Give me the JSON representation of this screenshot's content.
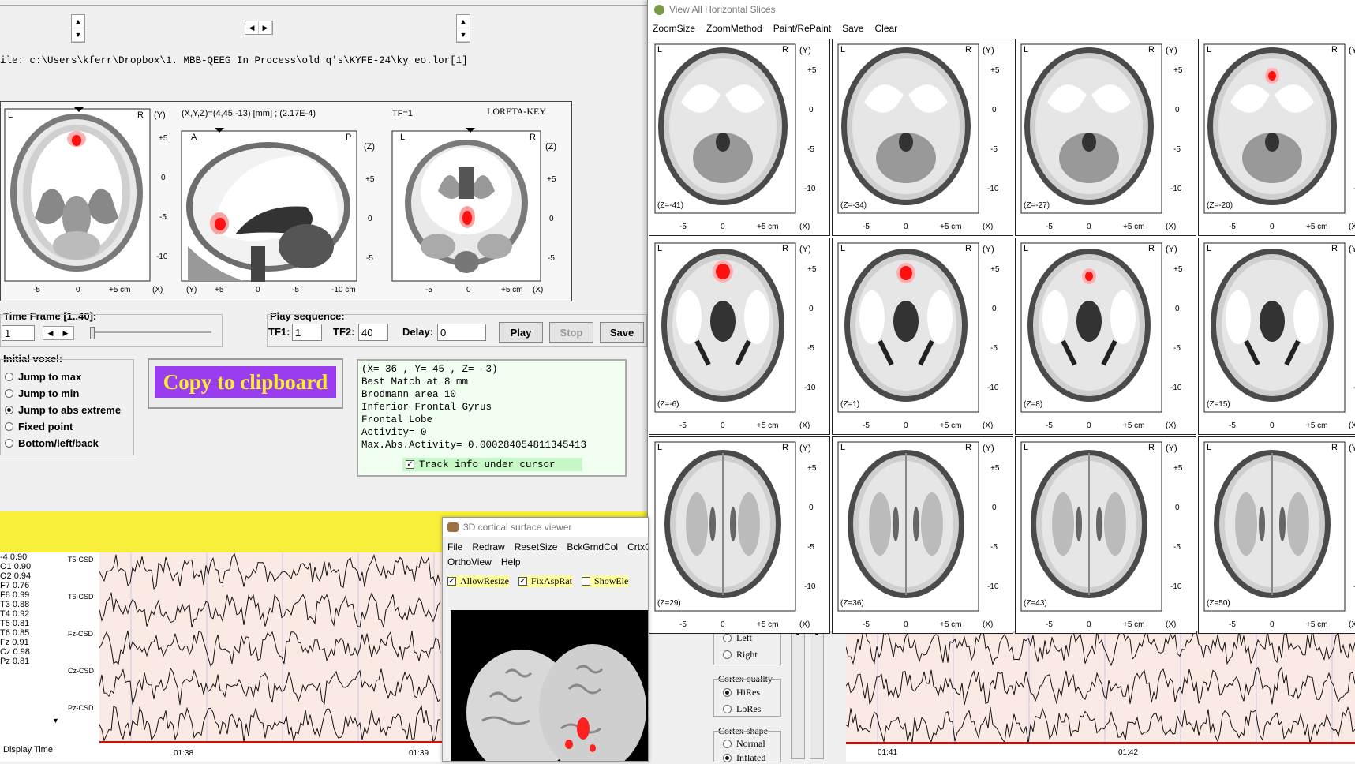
{
  "main": {
    "file_path": "ile: c:\\Users\\kferr\\Dropbox\\1. MBB-QEEG In Process\\old q's\\KYFE-24\\ky eo.lor[1]",
    "coords_readout": "(X,Y,Z)=(4,45,-13) [mm] ; (2.17E-4)",
    "tf_readout": "TF=1",
    "brand": "LORETA-KEY",
    "time_frame_label": "Time Frame [1..40]:",
    "time_frame_value": "1",
    "play_sequence_label": "Play sequence:",
    "tf1_label": "TF1:",
    "tf1_value": "1",
    "tf2_label": "TF2:",
    "tf2_value": "40",
    "delay_label": "Delay:",
    "delay_value": "0",
    "play_label": "Play",
    "stop_label": "Stop",
    "save_label": "Save",
    "initial_voxel_label": "Initial voxel:",
    "radios": [
      {
        "label": "Jump to max",
        "selected": false
      },
      {
        "label": "Jump to min",
        "selected": false
      },
      {
        "label": "Jump to abs extreme",
        "selected": true
      },
      {
        "label": "Fixed point",
        "selected": false
      },
      {
        "label": "Bottom/left/back",
        "selected": false
      }
    ],
    "copy_label": "Copy to clipboard",
    "info_lines": [
      "(X= 36 , Y= 45 , Z= -3)",
      "Best Match at 8 mm",
      "Brodmann area 10",
      "Inferior Frontal Gyrus",
      "Frontal Lobe",
      "Activity= 0",
      "Max.Abs.Activity= 0.000284054811345413"
    ],
    "track_label": "Track info under cursor",
    "axial": {
      "left": "L",
      "right": "R",
      "axis": "(Y)",
      "xaxis": "(X)",
      "yticks": [
        "+5",
        "0",
        "-5",
        "-10"
      ],
      "xticks": [
        "-5",
        "0",
        "+5 cm"
      ]
    },
    "sagittal": {
      "left": "A",
      "right": "P",
      "axis": "(Z)",
      "xaxis": "(Y)",
      "yticks": [
        "+5",
        "0",
        "-5"
      ],
      "xticks": [
        "+5",
        "0",
        "-5",
        "-10 cm"
      ]
    },
    "coronal": {
      "left": "L",
      "right": "R",
      "axis": "(Z)",
      "xaxis": "(X)",
      "yticks": [
        "+5",
        "0",
        "-5"
      ],
      "xticks": [
        "-5",
        "0",
        "+5 cm"
      ]
    }
  },
  "eeg_left": {
    "channels": [
      "T5-CSD",
      "T6-CSD",
      "Fz-CSD",
      "Cz-CSD",
      "Pz-CSD"
    ],
    "time_ticks": [
      "01:38",
      "01:39"
    ],
    "display_time_label": "Display Time",
    "value_rows": [
      "-4 0.90",
      "O1 0.90",
      "O2 0.94",
      "F7 0.76",
      "F8 0.99",
      "T3 0.88",
      "T4 0.92",
      "T5 0.81",
      "T6 0.85",
      "Fz 0.91",
      "Cz 0.98",
      "Pz 0.81"
    ]
  },
  "eeg_right": {
    "time_ticks": [
      "01:41",
      "01:42"
    ]
  },
  "hwin": {
    "title": "View All Horizontal Slices",
    "menu": [
      "ZoomSize",
      "ZoomMethod",
      "Paint/RePaint",
      "Save",
      "Clear"
    ],
    "left_label": "L",
    "right_label": "R",
    "yaxis": "(Y)",
    "xaxis": "(X)",
    "yticks": [
      "+5",
      "0",
      "-5",
      "-10"
    ],
    "xticks": [
      "-5",
      "0",
      "+5 cm"
    ],
    "slices": [
      "(Z=-41)",
      "(Z=-34)",
      "(Z=-27)",
      "(Z=-20)",
      "(Z=-6)",
      "(Z=1)",
      "(Z=8)",
      "(Z=15)",
      "(Z=29)",
      "(Z=36)",
      "(Z=43)",
      "(Z=50)"
    ]
  },
  "viewer": {
    "title": "3D cortical surface viewer",
    "menu_row1": [
      "File",
      "Redraw",
      "ResetSize",
      "BckGrndCol",
      "CrtxC"
    ],
    "menu_row2": [
      "OrthoView",
      "Help"
    ],
    "checks": [
      {
        "label": "AllowResize",
        "checked": true
      },
      {
        "label": "FixAspRat",
        "checked": true
      },
      {
        "label": "ShowEle",
        "checked": false
      }
    ]
  },
  "side_panel": {
    "left_label": "Left",
    "right_label": "Right",
    "cortex_quality_label": "Cortex quality",
    "hires_label": "HiRes",
    "lores_label": "LoRes",
    "cortex_shape_label": "Cortex shape",
    "normal_label": "Normal",
    "inflated_label": "Inflated"
  },
  "colors": {
    "yellow_band": "#f7ef3a",
    "copy_bg": "#9a3cf0",
    "copy_text": "#ffee33",
    "info_bg": "#f0fff0",
    "track_bg": "#c7f7c7",
    "eeg_bg": "#fbe9e3",
    "activation": "#ff1010"
  }
}
